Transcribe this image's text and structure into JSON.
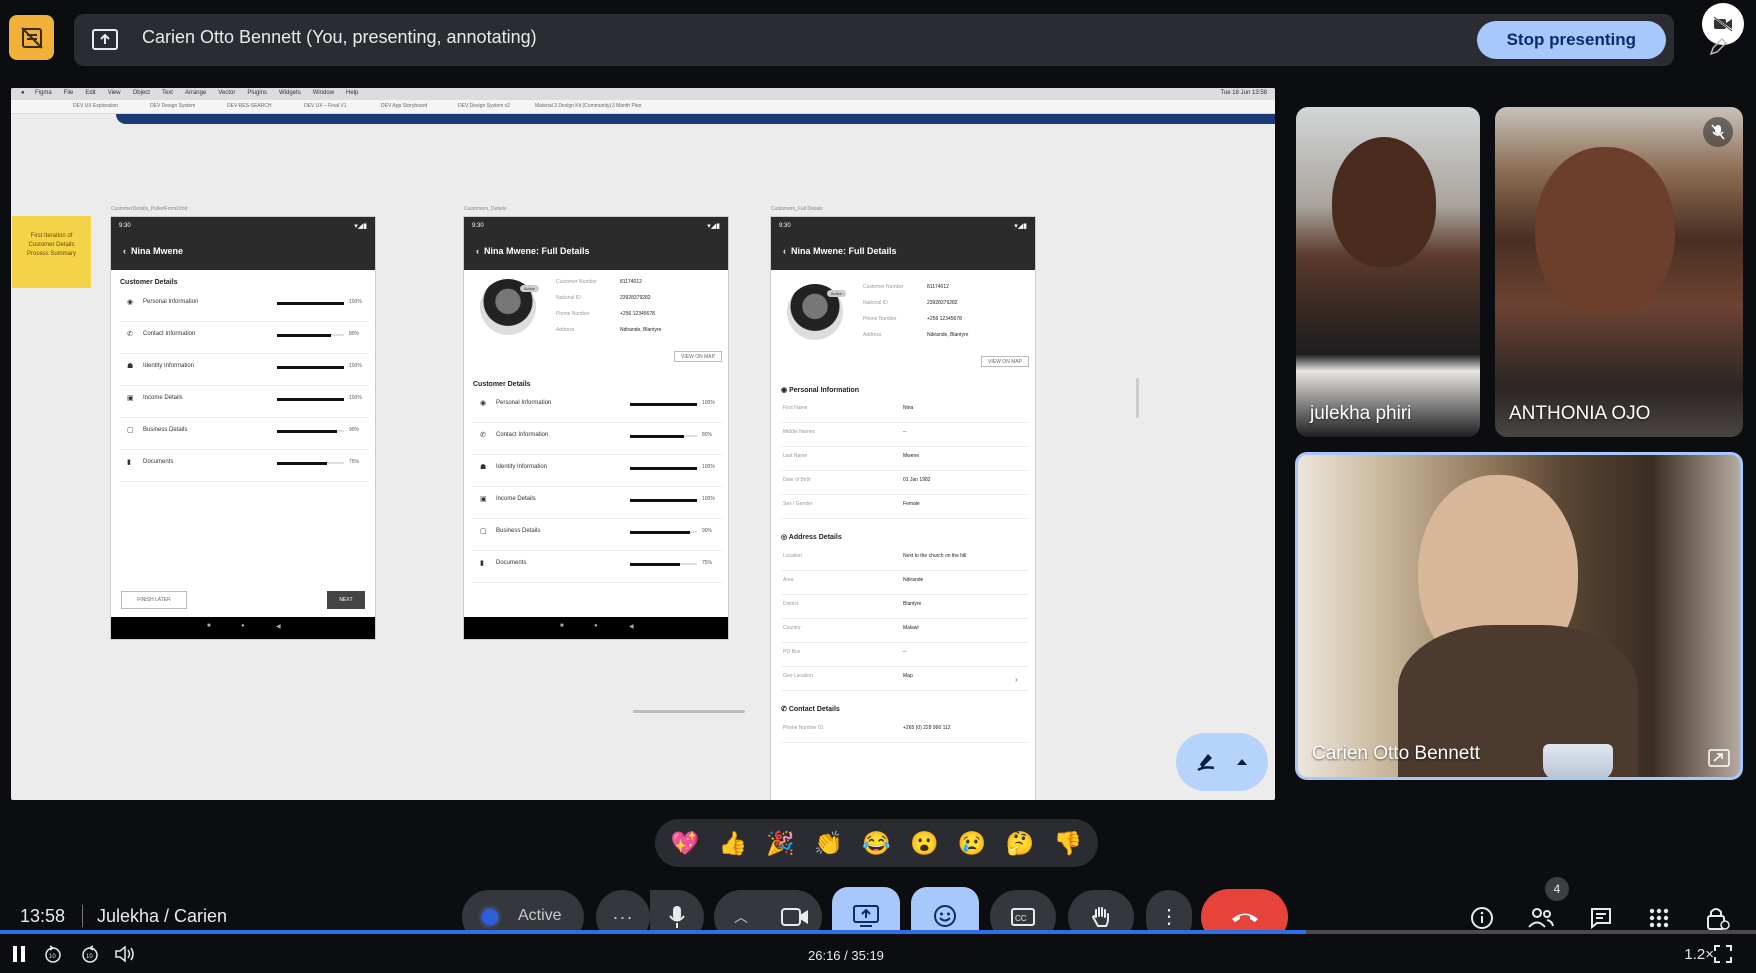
{
  "top_bar": {
    "presenter_title": "Carien Otto Bennett (You, presenting, annotating)",
    "stop_label": "Stop presenting"
  },
  "shared_screen": {
    "menus": [
      "Figma",
      "File",
      "Edit",
      "View",
      "Object",
      "Text",
      "Arrange",
      "Vector",
      "Plugins",
      "Widgets",
      "Window",
      "Help"
    ],
    "clock": "Tue 18 Jun 13:58",
    "tabs": [
      "DEV UX Exploration",
      "DEV Design System",
      "DEV-RES-SEARCH",
      "DEV UX – Final V1",
      "DEV App Storyboard",
      "DEV Design System v2",
      "Material 3 Design Kit (Community)",
      "3 Month Plan"
    ],
    "sticky_note": "First Iteration of Customer Details Process Summary",
    "frames": [
      {
        "label": "CustomerDetails_PulledFromOrbit",
        "time": "9:30",
        "title": "Nina Mwene",
        "section": "Customer Details",
        "items": [
          {
            "label": "Personal Information",
            "pct": "100%",
            "value": 100
          },
          {
            "label": "Contact Information",
            "pct": "80%",
            "value": 80
          },
          {
            "label": "Identity Information",
            "pct": "100%",
            "value": 100
          },
          {
            "label": "Income Details",
            "pct": "100%",
            "value": 100
          },
          {
            "label": "Business Details",
            "pct": "90%",
            "value": 90
          },
          {
            "label": "Documents",
            "pct": "75%",
            "value": 75
          }
        ],
        "finish_later": "FINISH LATER",
        "next": "NEXT"
      },
      {
        "label": "Customers_Details",
        "time": "9:30",
        "title": "Nina Mwene: Full Details",
        "badge": "Active",
        "info": [
          {
            "k": "Customer Number",
            "v": "81174012"
          },
          {
            "k": "National ID",
            "v": "23928379282"
          },
          {
            "k": "Phone Number",
            "v": "+256 12345678"
          },
          {
            "k": "Address",
            "v": "Ndirande, Blantyre"
          }
        ],
        "map_btn": "VIEW ON MAP",
        "section": "Customer Details",
        "items": [
          {
            "label": "Personal Information",
            "pct": "100%",
            "value": 100
          },
          {
            "label": "Contact Information",
            "pct": "80%",
            "value": 80
          },
          {
            "label": "Identity Information",
            "pct": "100%",
            "value": 100
          },
          {
            "label": "Income Details",
            "pct": "100%",
            "value": 100
          },
          {
            "label": "Business Details",
            "pct": "90%",
            "value": 90
          },
          {
            "label": "Documents",
            "pct": "75%",
            "value": 75
          }
        ]
      },
      {
        "label": "Customers_Full Details",
        "time": "9:30",
        "title": "Nina Mwene: Full Details",
        "badge": "Active",
        "info": [
          {
            "k": "Customer Number",
            "v": "81174012"
          },
          {
            "k": "National ID",
            "v": "23928379282"
          },
          {
            "k": "Phone Number",
            "v": "+256 12345678"
          },
          {
            "k": "Address",
            "v": "Ndirande, Blantyre"
          }
        ],
        "map_btn": "VIEW ON MAP",
        "personal_title": "Personal Information",
        "personal": [
          {
            "k": "First Name",
            "v": "Nina"
          },
          {
            "k": "Middle Names",
            "v": "--"
          },
          {
            "k": "Last Name",
            "v": "Mwene"
          },
          {
            "k": "Date of Birth",
            "v": "01 Jan 1982"
          },
          {
            "k": "Sex / Gender",
            "v": "Female"
          }
        ],
        "address_title": "Address Details",
        "address": [
          {
            "k": "Location",
            "v": "Next to the church on the hill"
          },
          {
            "k": "Area",
            "v": "Ndirande"
          },
          {
            "k": "District",
            "v": "Blantyre"
          },
          {
            "k": "Country",
            "v": "Malawi"
          },
          {
            "k": "PO Box",
            "v": "--"
          },
          {
            "k": "Geo Location",
            "v": "Map"
          }
        ],
        "contact_title": "Contact Details",
        "contact": [
          {
            "k": "Phone Number 01",
            "v": "+265 (0) 228 990 112"
          }
        ]
      }
    ]
  },
  "participants": [
    {
      "name": "julekha phiri"
    },
    {
      "name": "ANTHONIA OJO"
    },
    {
      "name": "Carien Otto Bennett"
    }
  ],
  "reactions": [
    "💖",
    "👍",
    "🎉",
    "👏",
    "😂",
    "😮",
    "😢",
    "🤔",
    "👎"
  ],
  "bottom": {
    "meeting_time": "13:58",
    "meeting_name": "Julekha / Carien",
    "active_label": "Active",
    "people_count": "4"
  },
  "player": {
    "time": "26:16 / 35:19",
    "speed": "1.2×",
    "progress": 0.744
  },
  "colors": {
    "accent": "#a8c7fa",
    "leave": "#e8433a",
    "progress": "#2f6fe6",
    "notes": "#f2b23a"
  }
}
